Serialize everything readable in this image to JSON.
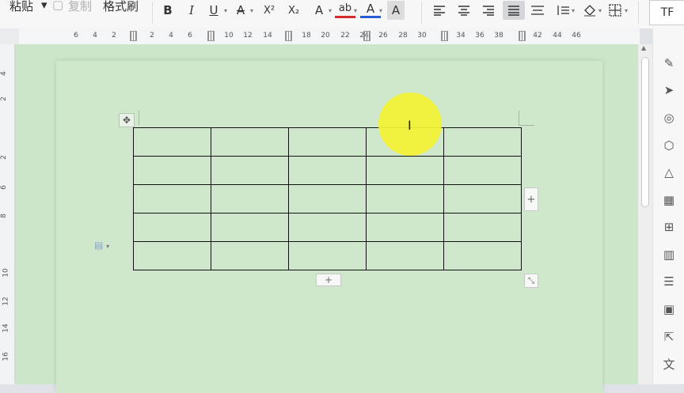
{
  "ribbon": {
    "paste_label": "粘贴",
    "copy_label": "复制",
    "format_painter_label": "格式刷",
    "bold": "B",
    "italic": "I",
    "underline": "U",
    "strikethrough": "A",
    "superscript": "X²",
    "subscript": "X₂",
    "font_effect": "A",
    "highlight": "ab",
    "font_color": "A",
    "char_shading": "A",
    "corner_label": "TF"
  },
  "ruler": {
    "ticks": [
      "6",
      "4",
      "2",
      "2",
      "4",
      "6",
      "10",
      "12",
      "14",
      "18",
      "20",
      "22",
      "24",
      "26",
      "28",
      "30",
      "34",
      "36",
      "38",
      "42",
      "44",
      "46"
    ]
  },
  "vertical_ruler": {
    "ticks": [
      "4",
      "2",
      "2",
      "6",
      "8",
      "10",
      "12",
      "14",
      "16"
    ]
  },
  "table": {
    "rows": 5,
    "cols": 5
  },
  "table_controls": {
    "move_icon": "move-icon",
    "add_column": "+",
    "add_row": "+"
  },
  "colors": {
    "canvas": "#cce6c9",
    "highlight": "#f2f234",
    "font_color_underline": "#2a5bd7",
    "highlight_underline": "#d62b2b"
  }
}
